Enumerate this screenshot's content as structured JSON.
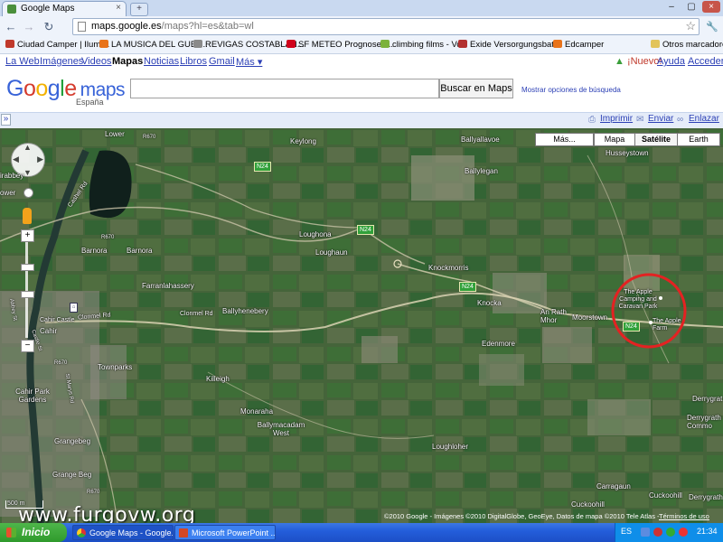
{
  "browser": {
    "tab_title": "Google Maps",
    "tab_close": "×",
    "new_tab": "+",
    "window_buttons": [
      "–",
      "▢",
      "×"
    ],
    "nav_back": "←",
    "nav_forward": "→",
    "nav_reload": "↻",
    "url_host": "maps.google.es",
    "url_path": "/maps?hl=es&tab=wl",
    "star": "☆",
    "wrench": "🔧"
  },
  "bookmarks": [
    {
      "label": "Ciudad Camper | Ilumi...",
      "color": "#c0392b"
    },
    {
      "label": "LA MUSICA DEL GUET...",
      "color": "#e8731a"
    },
    {
      "label": "REVIGAS COSTABLAN...",
      "color": "#8a8a8a"
    },
    {
      "label": "SF METEO Prognosen...",
      "color": "#d0021b"
    },
    {
      "label": "climbing films - Vox",
      "color": "#7bb23b"
    },
    {
      "label": "Exide Versorgungsbat...",
      "color": "#b23030"
    },
    {
      "label": "Edcamper",
      "color": "#e8731a"
    },
    {
      "label": "Otros marcadores",
      "color": "#e2c45a"
    }
  ],
  "google_links": [
    "La Web",
    "Imágenes",
    "Videos",
    "Mapas",
    "Noticias",
    "Libros",
    "Gmail",
    "Más ▾"
  ],
  "account_links": [
    "¡Nuevo!",
    "Ayuda",
    "Acceder"
  ],
  "search": {
    "logo_word": "Google",
    "logo_maps": "maps",
    "logo_sub": "España",
    "value": "",
    "button": "Buscar en Maps",
    "advanced": "Mostrar opciones de búsqueda"
  },
  "toolbar": {
    "collapse": "»",
    "print": "Imprimir",
    "send": "Enviar",
    "link": "Enlazar"
  },
  "map": {
    "types": [
      "Más...",
      "Mapa",
      "Satélite",
      "Earth"
    ],
    "selected_type": "Satélite",
    "labels": [
      "Lower",
      "R670",
      "Keylong",
      "Ballyallavoe",
      "Husseystown",
      "irabbey",
      "ower",
      "Ballylegan",
      "Loughona",
      "Loughaun",
      "R670",
      "Barnora",
      "Barnora",
      "Knockmorris",
      "Farranlahassery",
      "Knocka",
      "The Apple Camping and Caravan Park",
      "Ballyhenebery",
      "Clonmel Rd",
      "An Rath Mhor",
      "Moorstown",
      "The Apple Farm",
      "Cahir Castle",
      "Cahir",
      "Edenmore",
      "R670",
      "Townparks",
      "Killeigh",
      "Derrygrat",
      "Cahir Park Gardens",
      "Monaraha",
      "Derrygrath Commo",
      "Ballymacadam West",
      "Grangebeg",
      "Loughloher",
      "Grange Beg",
      "R670",
      "Carragaun",
      "Cuckoohill",
      "Cuckoohill",
      "Derrygrath",
      "Cashel Rd",
      "Clonmel Rd",
      "Castle St",
      "St Marys Rd",
      "Abbey St"
    ],
    "road_shields": [
      "N24",
      "N24",
      "N24",
      "N24"
    ],
    "scale": "500 m",
    "copyright": "©2010 Google - Imágenes ©2010 DigitalGlobe, GeoEye, Datos de mapa ©2010 Tele Atlas -",
    "terms": "Términos de uso"
  },
  "taskbar": {
    "start": "Inicio",
    "tasks": [
      "Google Maps - Google...",
      "Microsoft PowerPoint ..."
    ],
    "lang": "ES",
    "clock": "21:34"
  },
  "watermark": "www.furgovw.org"
}
